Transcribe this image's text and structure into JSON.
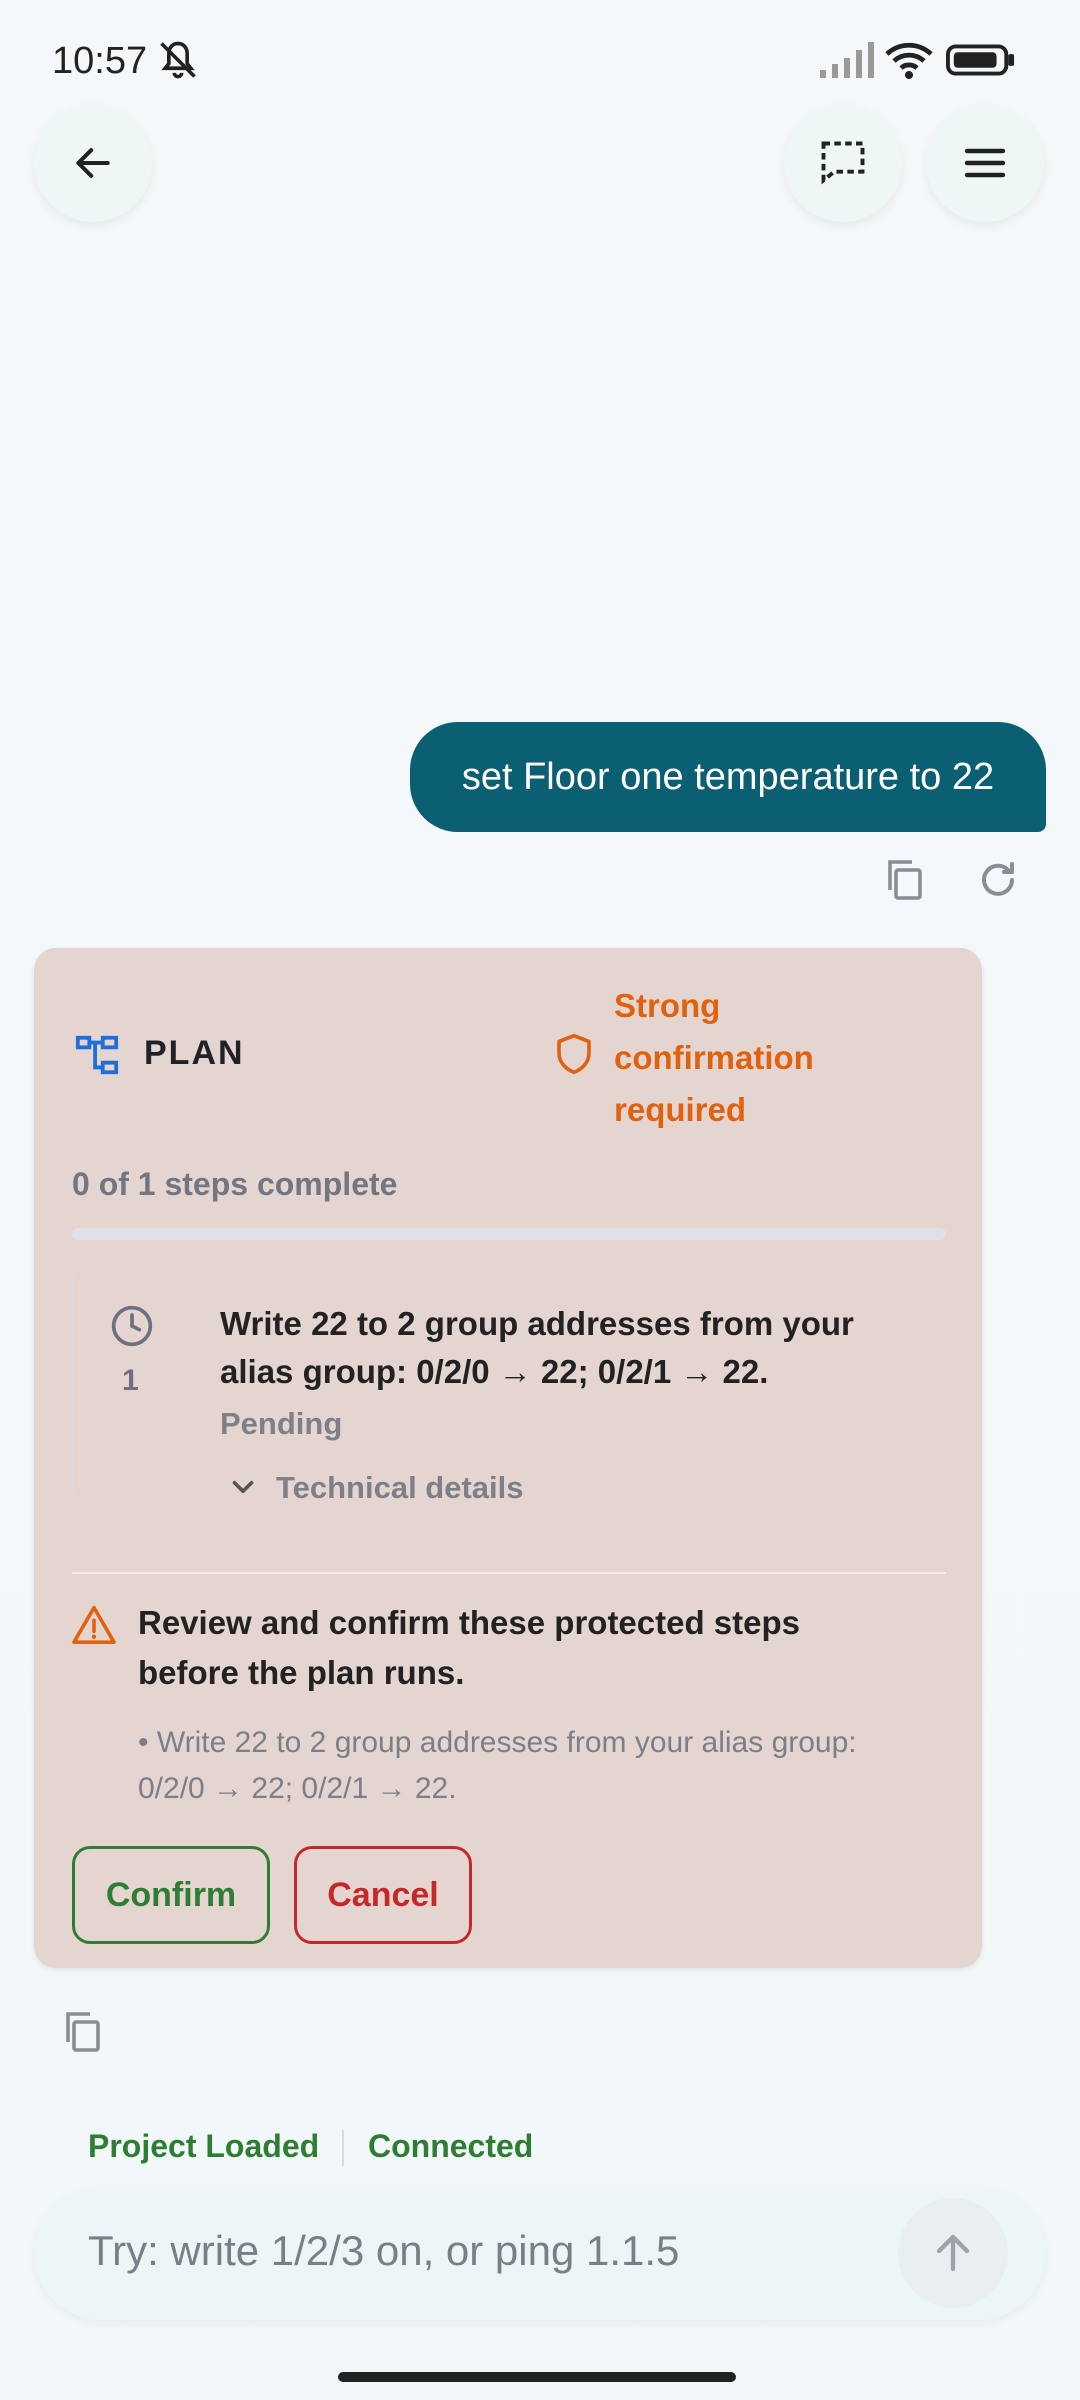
{
  "status_bar": {
    "time": "10:57"
  },
  "conversation": {
    "user_message": "set Floor one temperature to 22"
  },
  "plan": {
    "title": "PLAN",
    "confirmation_badge": "Strong confirmation required",
    "progress_text": "0 of 1 steps complete",
    "progress_fraction": 0,
    "steps": [
      {
        "number": "1",
        "text": "Write 22 to 2 group addresses from your alias group: 0/2/0 → 22; 0/2/1 → 22.",
        "status": "Pending",
        "details_label": "Technical details"
      }
    ],
    "warning": {
      "title": "Review and confirm these protected steps before the plan runs.",
      "items": [
        "• Write 22 to 2 group addresses from your alias group: 0/2/0 → 22; 0/2/1 → 22."
      ]
    },
    "confirm_label": "Confirm",
    "cancel_label": "Cancel"
  },
  "footer_status": {
    "project": "Project Loaded",
    "connection": "Connected"
  },
  "composer": {
    "placeholder": "Try: write 1/2/3 on, or ping 1.1.5"
  },
  "colors": {
    "user_bubble": "#0b5f73",
    "plan_card": "#e5d5d0",
    "warning_orange": "#e0620e",
    "confirm_green": "#2e7d32",
    "cancel_red": "#c62828"
  }
}
